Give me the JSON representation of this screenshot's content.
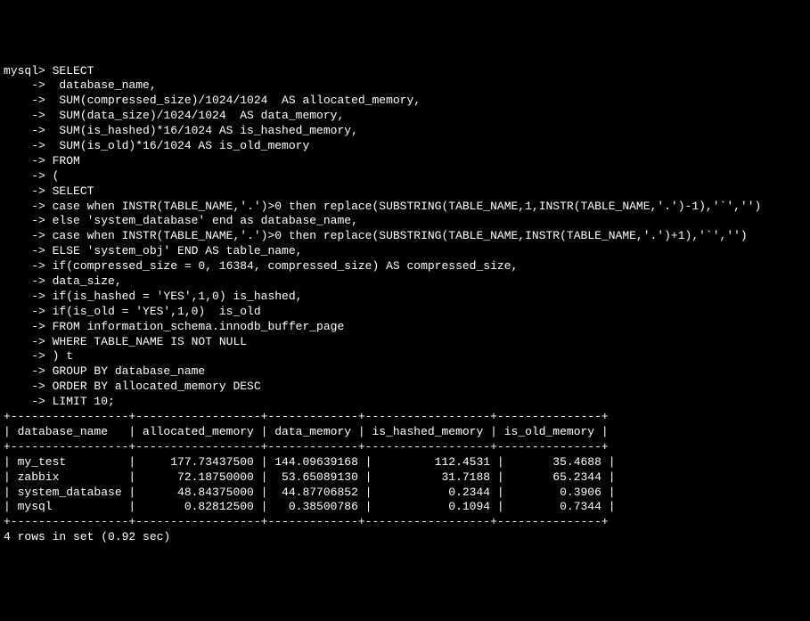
{
  "prompt": "mysql>",
  "continuation": "    ->",
  "query_lines": [
    " SELECT",
    "  database_name,",
    "  SUM(compressed_size)/1024/1024  AS allocated_memory,",
    "  SUM(data_size)/1024/1024  AS data_memory,",
    "  SUM(is_hashed)*16/1024 AS is_hashed_memory,",
    "  SUM(is_old)*16/1024 AS is_old_memory",
    " FROM",
    " (",
    " SELECT",
    " case when INSTR(TABLE_NAME,'.')>0 then replace(SUBSTRING(TABLE_NAME,1,INSTR(TABLE_NAME,'.')-1),'`','')",
    " else 'system_database' end as database_name,",
    " case when INSTR(TABLE_NAME,'.')>0 then replace(SUBSTRING(TABLE_NAME,INSTR(TABLE_NAME,'.')+1),'`','')",
    " ELSE 'system_obj' END AS table_name,",
    " if(compressed_size = 0, 16384, compressed_size) AS compressed_size,",
    " data_size,",
    " if(is_hashed = 'YES',1,0) is_hashed,",
    " if(is_old = 'YES',1,0)  is_old",
    " FROM information_schema.innodb_buffer_page",
    " WHERE TABLE_NAME IS NOT NULL",
    " ) t",
    " GROUP BY database_name",
    " ORDER BY allocated_memory DESC",
    " LIMIT 10;"
  ],
  "table": {
    "separator_top": "+-----------------+------------------+-------------+------------------+---------------+",
    "header_line": "| database_name   | allocated_memory | data_memory | is_hashed_memory | is_old_memory |",
    "separator_mid": "+-----------------+------------------+-------------+------------------+---------------+",
    "rows": [
      "| my_test         |     177.73437500 | 144.09639168 |         112.4531 |       35.4688 |",
      "| zabbix          |      72.18750000 |  53.65089130 |          31.7188 |       65.2344 |",
      "| system_database |      48.84375000 |  44.87706852 |           0.2344 |        0.3906 |",
      "| mysql           |       0.82812500 |   0.38500786 |           0.1094 |        0.7344 |"
    ],
    "separator_bot": "+-----------------+------------------+-------------+------------------+---------------+"
  },
  "footer": "4 rows in set (0.92 sec)"
}
